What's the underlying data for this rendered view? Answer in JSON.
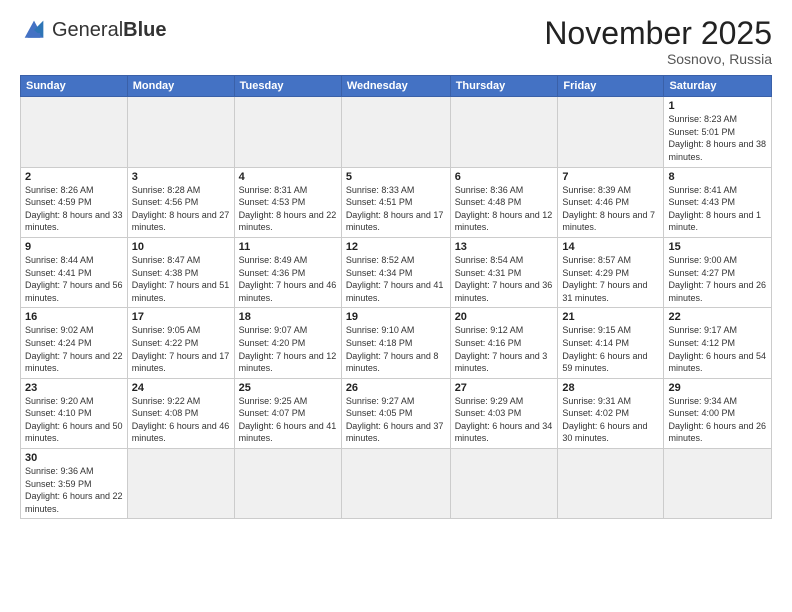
{
  "logo": {
    "text_normal": "General",
    "text_bold": "Blue"
  },
  "title": "November 2025",
  "subtitle": "Sosnovo, Russia",
  "days_of_week": [
    "Sunday",
    "Monday",
    "Tuesday",
    "Wednesday",
    "Thursday",
    "Friday",
    "Saturday"
  ],
  "weeks": [
    [
      {
        "day": "",
        "info": ""
      },
      {
        "day": "",
        "info": ""
      },
      {
        "day": "",
        "info": ""
      },
      {
        "day": "",
        "info": ""
      },
      {
        "day": "",
        "info": ""
      },
      {
        "day": "",
        "info": ""
      },
      {
        "day": "1",
        "info": "Sunrise: 8:23 AM\nSunset: 5:01 PM\nDaylight: 8 hours and 38 minutes."
      }
    ],
    [
      {
        "day": "2",
        "info": "Sunrise: 8:26 AM\nSunset: 4:59 PM\nDaylight: 8 hours and 33 minutes."
      },
      {
        "day": "3",
        "info": "Sunrise: 8:28 AM\nSunset: 4:56 PM\nDaylight: 8 hours and 27 minutes."
      },
      {
        "day": "4",
        "info": "Sunrise: 8:31 AM\nSunset: 4:53 PM\nDaylight: 8 hours and 22 minutes."
      },
      {
        "day": "5",
        "info": "Sunrise: 8:33 AM\nSunset: 4:51 PM\nDaylight: 8 hours and 17 minutes."
      },
      {
        "day": "6",
        "info": "Sunrise: 8:36 AM\nSunset: 4:48 PM\nDaylight: 8 hours and 12 minutes."
      },
      {
        "day": "7",
        "info": "Sunrise: 8:39 AM\nSunset: 4:46 PM\nDaylight: 8 hours and 7 minutes."
      },
      {
        "day": "8",
        "info": "Sunrise: 8:41 AM\nSunset: 4:43 PM\nDaylight: 8 hours and 1 minute."
      }
    ],
    [
      {
        "day": "9",
        "info": "Sunrise: 8:44 AM\nSunset: 4:41 PM\nDaylight: 7 hours and 56 minutes."
      },
      {
        "day": "10",
        "info": "Sunrise: 8:47 AM\nSunset: 4:38 PM\nDaylight: 7 hours and 51 minutes."
      },
      {
        "day": "11",
        "info": "Sunrise: 8:49 AM\nSunset: 4:36 PM\nDaylight: 7 hours and 46 minutes."
      },
      {
        "day": "12",
        "info": "Sunrise: 8:52 AM\nSunset: 4:34 PM\nDaylight: 7 hours and 41 minutes."
      },
      {
        "day": "13",
        "info": "Sunrise: 8:54 AM\nSunset: 4:31 PM\nDaylight: 7 hours and 36 minutes."
      },
      {
        "day": "14",
        "info": "Sunrise: 8:57 AM\nSunset: 4:29 PM\nDaylight: 7 hours and 31 minutes."
      },
      {
        "day": "15",
        "info": "Sunrise: 9:00 AM\nSunset: 4:27 PM\nDaylight: 7 hours and 26 minutes."
      }
    ],
    [
      {
        "day": "16",
        "info": "Sunrise: 9:02 AM\nSunset: 4:24 PM\nDaylight: 7 hours and 22 minutes."
      },
      {
        "day": "17",
        "info": "Sunrise: 9:05 AM\nSunset: 4:22 PM\nDaylight: 7 hours and 17 minutes."
      },
      {
        "day": "18",
        "info": "Sunrise: 9:07 AM\nSunset: 4:20 PM\nDaylight: 7 hours and 12 minutes."
      },
      {
        "day": "19",
        "info": "Sunrise: 9:10 AM\nSunset: 4:18 PM\nDaylight: 7 hours and 8 minutes."
      },
      {
        "day": "20",
        "info": "Sunrise: 9:12 AM\nSunset: 4:16 PM\nDaylight: 7 hours and 3 minutes."
      },
      {
        "day": "21",
        "info": "Sunrise: 9:15 AM\nSunset: 4:14 PM\nDaylight: 6 hours and 59 minutes."
      },
      {
        "day": "22",
        "info": "Sunrise: 9:17 AM\nSunset: 4:12 PM\nDaylight: 6 hours and 54 minutes."
      }
    ],
    [
      {
        "day": "23",
        "info": "Sunrise: 9:20 AM\nSunset: 4:10 PM\nDaylight: 6 hours and 50 minutes."
      },
      {
        "day": "24",
        "info": "Sunrise: 9:22 AM\nSunset: 4:08 PM\nDaylight: 6 hours and 46 minutes."
      },
      {
        "day": "25",
        "info": "Sunrise: 9:25 AM\nSunset: 4:07 PM\nDaylight: 6 hours and 41 minutes."
      },
      {
        "day": "26",
        "info": "Sunrise: 9:27 AM\nSunset: 4:05 PM\nDaylight: 6 hours and 37 minutes."
      },
      {
        "day": "27",
        "info": "Sunrise: 9:29 AM\nSunset: 4:03 PM\nDaylight: 6 hours and 34 minutes."
      },
      {
        "day": "28",
        "info": "Sunrise: 9:31 AM\nSunset: 4:02 PM\nDaylight: 6 hours and 30 minutes."
      },
      {
        "day": "29",
        "info": "Sunrise: 9:34 AM\nSunset: 4:00 PM\nDaylight: 6 hours and 26 minutes."
      }
    ],
    [
      {
        "day": "30",
        "info": "Sunrise: 9:36 AM\nSunset: 3:59 PM\nDaylight: 6 hours and 22 minutes."
      },
      {
        "day": "",
        "info": ""
      },
      {
        "day": "",
        "info": ""
      },
      {
        "day": "",
        "info": ""
      },
      {
        "day": "",
        "info": ""
      },
      {
        "day": "",
        "info": ""
      },
      {
        "day": "",
        "info": ""
      }
    ]
  ]
}
